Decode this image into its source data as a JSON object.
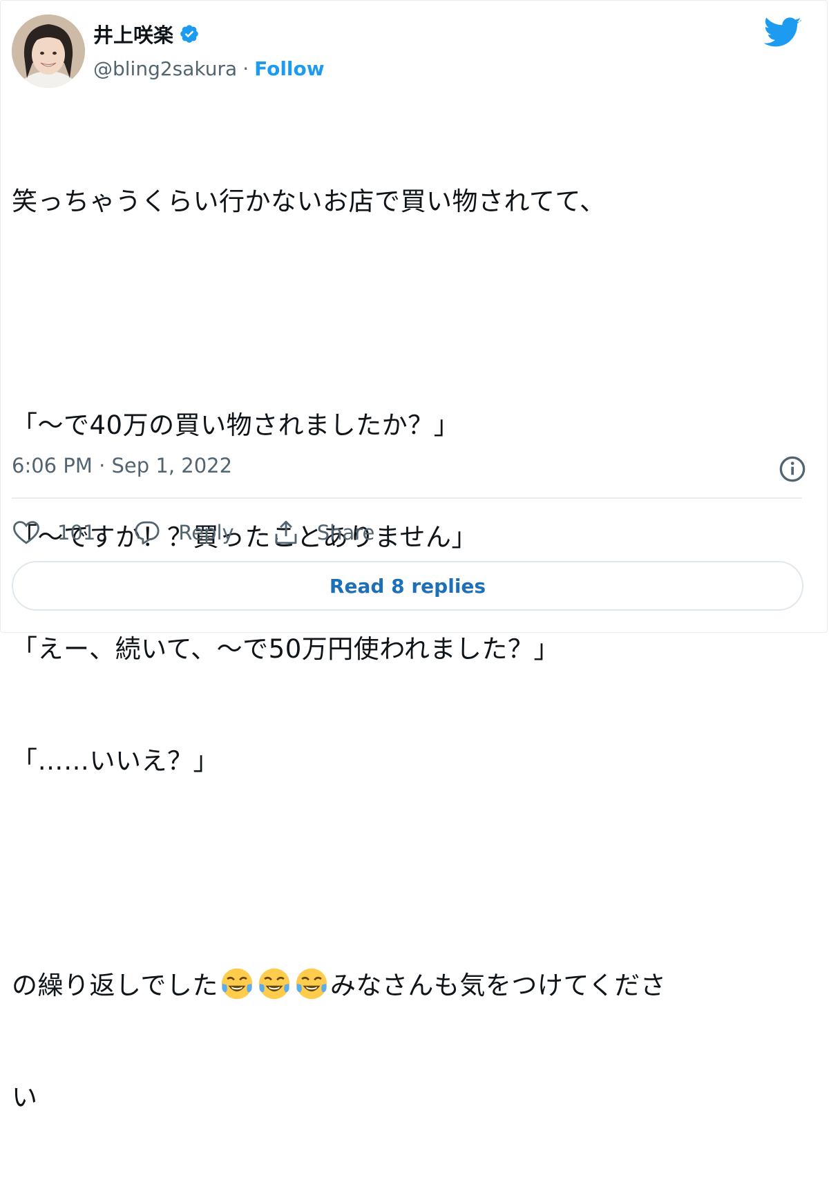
{
  "author": {
    "display_name": "井上咲楽",
    "handle": "@bling2sakura",
    "separator": "·",
    "follow_label": "Follow",
    "verified": true
  },
  "tweet": {
    "lines": [
      "笑っちゃうくらい行かないお店で買い物されてて、",
      "",
      "「～で40万の買い物されましたか？」",
      "「～ですか！？買ったことありません」",
      "「えー、続いて、～で50万円使われました？」",
      "「……いいえ？」",
      ""
    ],
    "last_before_emoji": "の繰り返しでした",
    "emoji": [
      "face-with-tears-of-joy",
      "face-with-tears-of-joy",
      "face-with-tears-of-joy"
    ],
    "last_after_emoji": "みなさんも気をつけてくださ",
    "last_line": "い",
    "timestamp": "6:06 PM · Sep 1, 2022"
  },
  "actions": {
    "like_count": "101",
    "reply_label": "Reply",
    "share_label": "Share"
  },
  "read_replies_label": "Read 8 replies",
  "colors": {
    "accent": "#1d9bf0",
    "text": "#0f1419",
    "muted": "#536471",
    "border": "#e6ecf0"
  }
}
